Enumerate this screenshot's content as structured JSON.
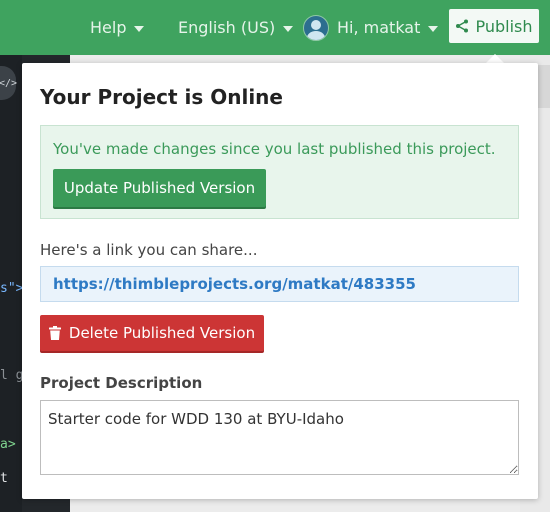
{
  "header": {
    "help_label": "Help",
    "language_label": "English (US)",
    "user_greeting": "Hi, matkat",
    "publish_label": "Publish"
  },
  "editor": {
    "fragments": [
      "s\">",
      "l g",
      "a>",
      "t"
    ]
  },
  "popup": {
    "title": "Your Project is Online",
    "changes_message": "You've made changes since you last published this project.",
    "update_button_label": "Update Published Version",
    "share_label": "Here's a link you can share...",
    "share_url": "https://thimbleprojects.org/matkat/483355",
    "delete_button_label": "Delete Published Version",
    "description_label": "Project Description",
    "description_value": "Starter code for WDD 130 at BYU-Idaho"
  },
  "colors": {
    "topbar": "#3fa35f",
    "update_button": "#3a9a58",
    "delete_button": "#cc3535",
    "link": "#2e7ac4"
  },
  "icons": [
    "chevron-down-icon",
    "avatar",
    "share-icon",
    "trash-icon",
    "code-icon"
  ]
}
